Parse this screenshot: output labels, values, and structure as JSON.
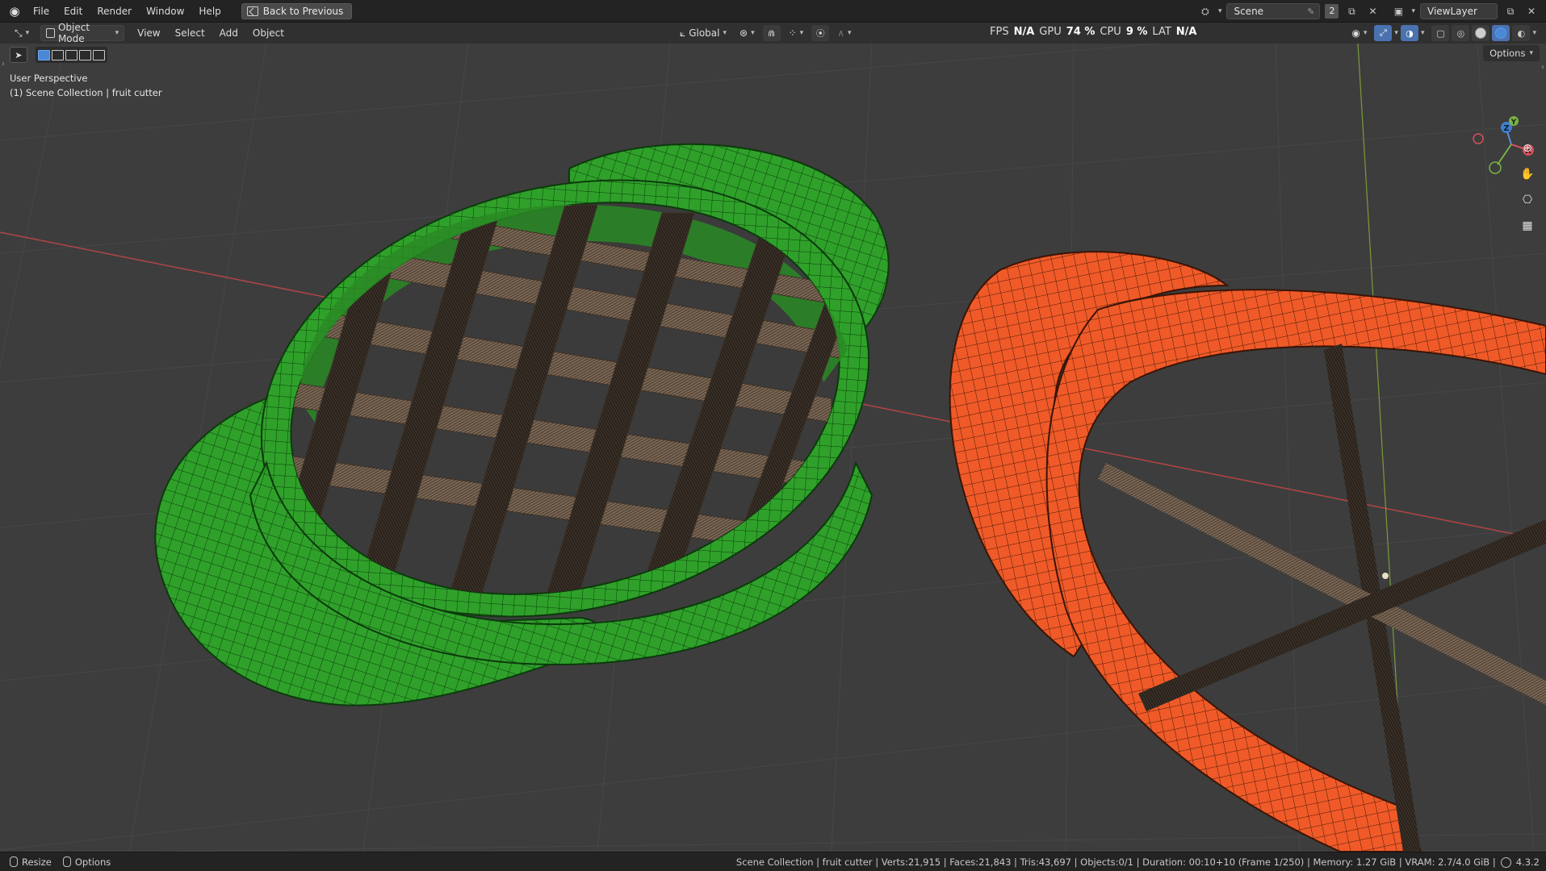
{
  "menubar": {
    "items": [
      "File",
      "Edit",
      "Render",
      "Window",
      "Help"
    ],
    "back_button": "Back to Previous",
    "scene_name": "Scene",
    "scene_count": "2",
    "view_layer": "ViewLayer"
  },
  "header": {
    "mode": "Object Mode",
    "menus": [
      "View",
      "Select",
      "Add",
      "Object"
    ],
    "transform_orientation": "Global",
    "perf": {
      "fps_label": "FPS",
      "fps_value": "N/A",
      "gpu_label": "GPU",
      "gpu_value": "74 %",
      "cpu_label": "CPU",
      "cpu_value": "9 %",
      "lat_label": "LAT",
      "lat_value": "N/A"
    }
  },
  "viewport": {
    "perspective": "User Perspective",
    "collection_path": "(1) Scene Collection | fruit cutter",
    "options_label": "Options",
    "gizmo_labels": {
      "z": "Z",
      "y": "Y",
      "x": "X"
    },
    "colors": {
      "background": "#3d3d3d",
      "grid": "#4a4a4a",
      "x_axis": "#b34545",
      "y_axis": "#7c9a3a",
      "green_cutter": "#2fa12a",
      "orange_cutter": "#f05a28",
      "blades": "#6b5a4a"
    }
  },
  "statusbar": {
    "left": [
      "Resize",
      "Options"
    ],
    "info": "Scene Collection | fruit cutter | Verts:21,915 | Faces:21,843 | Tris:43,697 | Objects:0/1 | Duration: 00:10+10 (Frame 1/250) | Memory: 1.27 GiB | VRAM: 2.7/4.0 GiB |",
    "version": "4.3.2"
  }
}
